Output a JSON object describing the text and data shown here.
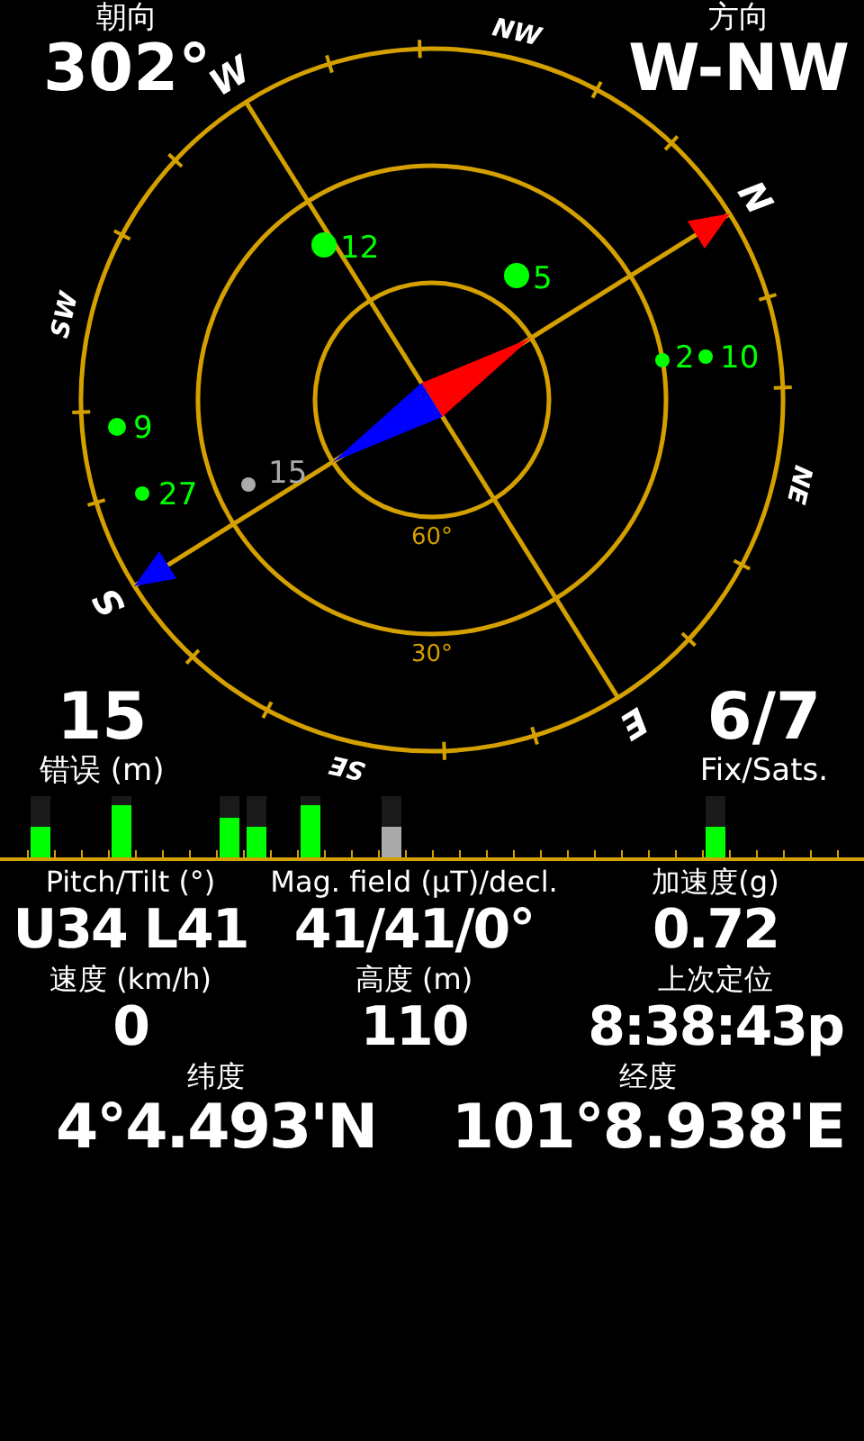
{
  "heading": {
    "label": "朝向",
    "value": "302°"
  },
  "direction": {
    "label": "方向",
    "value": "W-NW"
  },
  "compass": {
    "cardinals": [
      "N",
      "NE",
      "E",
      "SE",
      "S",
      "SW",
      "W",
      "NW"
    ],
    "elevations": [
      "60°",
      "30°"
    ]
  },
  "satellites": [
    {
      "prn": "12",
      "used": true
    },
    {
      "prn": "5",
      "used": true
    },
    {
      "prn": "2",
      "used": true
    },
    {
      "prn": "10",
      "used": true
    },
    {
      "prn": "9",
      "used": true
    },
    {
      "prn": "27",
      "used": true
    },
    {
      "prn": "15",
      "used": false
    }
  ],
  "error": {
    "value": "15",
    "label": "错误 (m)"
  },
  "fix": {
    "value": "6/7",
    "label": "Fix/Sats."
  },
  "signal_bars": [
    {
      "level": 0.5,
      "used": true
    },
    {
      "level": 0.85,
      "used": true
    },
    {
      "level": 0.65,
      "used": true
    },
    {
      "level": 0.5,
      "used": true
    },
    {
      "level": 0.85,
      "used": true
    },
    {
      "level": 0.5,
      "used": false
    },
    {
      "level": 0.5,
      "used": true
    }
  ],
  "readings_top": [
    {
      "label": "Pitch/Tilt (°)",
      "value": "U34 L41"
    },
    {
      "label": "Mag. field (µT)/decl.",
      "value": "41/41/0°"
    },
    {
      "label": "加速度(g)",
      "value": "0.72"
    },
    {
      "label": "速度 (km/h)",
      "value": "0"
    },
    {
      "label": "高度 (m)",
      "value": "110"
    },
    {
      "label": "上次定位",
      "value": "8:38:43p"
    }
  ],
  "readings_bottom": [
    {
      "label": "纬度",
      "value": "4°4.493'N"
    },
    {
      "label": "经度",
      "value": "101°8.938'E"
    }
  ]
}
